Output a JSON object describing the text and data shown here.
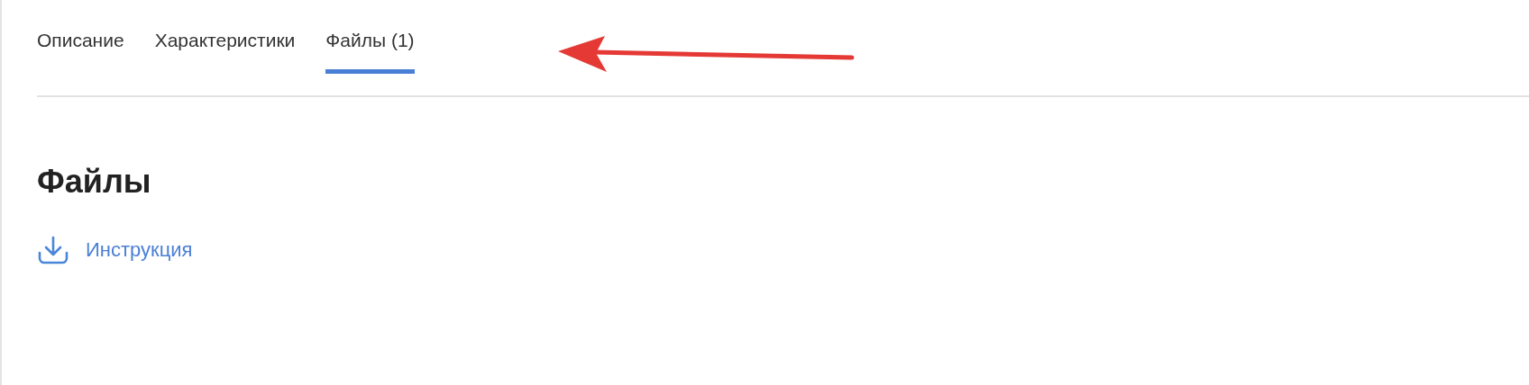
{
  "tabs": [
    {
      "label": "Описание",
      "selected": false
    },
    {
      "label": "Характеристики",
      "selected": false
    },
    {
      "label": "Файлы (1)",
      "selected": true
    }
  ],
  "heading": "Файлы",
  "files": [
    {
      "label": "Инструкция"
    }
  ]
}
